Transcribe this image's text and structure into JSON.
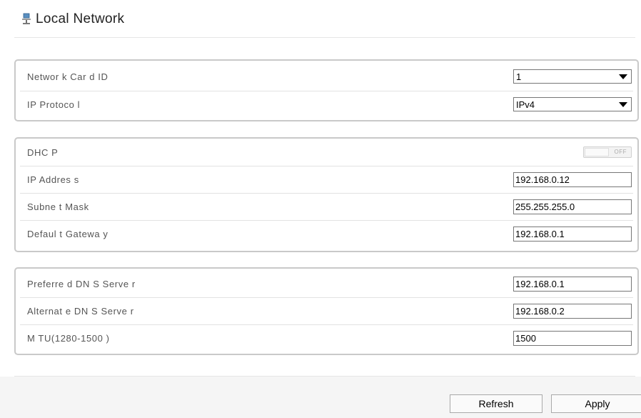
{
  "page": {
    "title": "Local Network",
    "icon": "network-icon"
  },
  "groups": {
    "card": {
      "network_card_id": {
        "label": "Networ k Car d ID",
        "value": "1"
      },
      "ip_protocol": {
        "label": "IP Protoco l",
        "value": "IPv4"
      }
    },
    "ip": {
      "dhcp": {
        "label": "DHC P",
        "state": "OFF"
      },
      "ip_address": {
        "label": "IP Addres s",
        "value": "192.168.0.12"
      },
      "subnet_mask": {
        "label": "Subne t Mask",
        "value": "255.255.255.0"
      },
      "default_gateway": {
        "label": "Defaul t Gatewa y",
        "value": "192.168.0.1"
      }
    },
    "dns": {
      "preferred_dns": {
        "label": "Preferre d DN S Serve r",
        "value": "192.168.0.1"
      },
      "alternate_dns": {
        "label": "Alternat e DN S Serve r",
        "value": "192.168.0.2"
      },
      "mtu": {
        "label": "M TU(1280-1500 )",
        "value": "1500"
      }
    }
  },
  "buttons": {
    "refresh": "Refresh",
    "apply": "Apply"
  },
  "colors": {
    "border": "#c9c9c9",
    "footer_bg": "#f5f5f5",
    "accent": "#3a78b5"
  }
}
